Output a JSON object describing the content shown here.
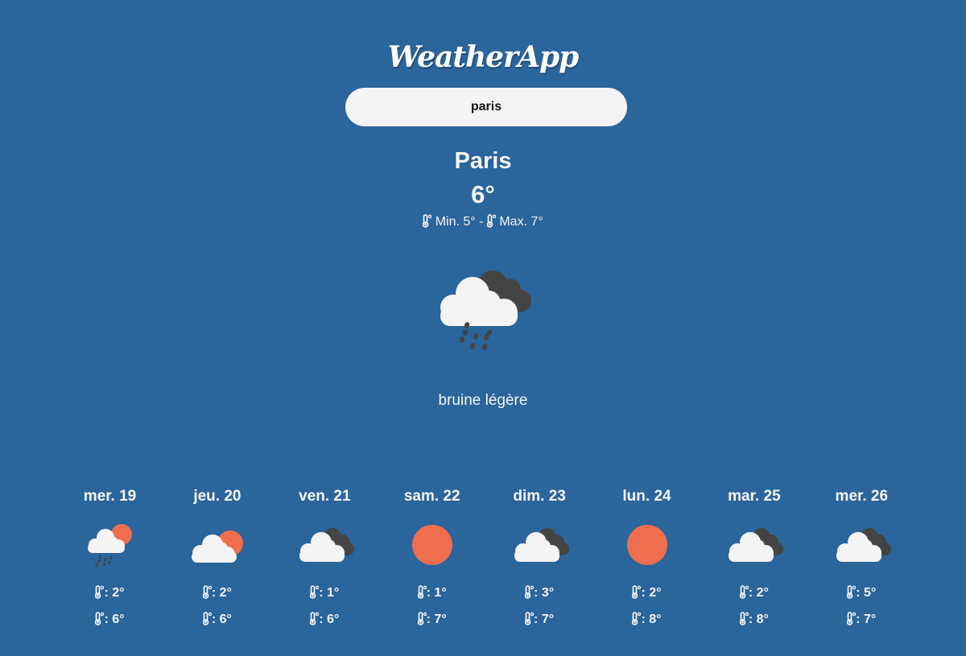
{
  "app": {
    "logo": "WeatherApp"
  },
  "search": {
    "value": "paris"
  },
  "current": {
    "city": "Paris",
    "temp": "6°",
    "min_label": "Min. 5°",
    "separator": "-",
    "max_label": "Max. 7°",
    "description": "bruine légère",
    "icon": "drizzle-cloud-icon"
  },
  "forecast": [
    {
      "label": "mer. 19",
      "min": ": 2°",
      "max": ": 6°",
      "icon": "sun-cloud-drizzle-icon"
    },
    {
      "label": "jeu. 20",
      "min": ": 2°",
      "max": ": 6°",
      "icon": "sun-cloud-icon"
    },
    {
      "label": "ven. 21",
      "min": ": 1°",
      "max": ": 6°",
      "icon": "clouds-icon"
    },
    {
      "label": "sam. 22",
      "min": ": 1°",
      "max": ": 7°",
      "icon": "sun-icon"
    },
    {
      "label": "dim. 23",
      "min": ": 3°",
      "max": ": 7°",
      "icon": "clouds-icon"
    },
    {
      "label": "lun. 24",
      "min": ": 2°",
      "max": ": 8°",
      "icon": "sun-icon"
    },
    {
      "label": "mar. 25",
      "min": ": 2°",
      "max": ": 8°",
      "icon": "clouds-icon"
    },
    {
      "label": "mer. 26",
      "min": ": 5°",
      "max": ": 7°",
      "icon": "clouds-icon"
    }
  ],
  "colors": {
    "background": "#2a659b",
    "cloud_light": "#f4f4f4",
    "cloud_dark": "#444444",
    "sun": "#ee6e4e"
  }
}
